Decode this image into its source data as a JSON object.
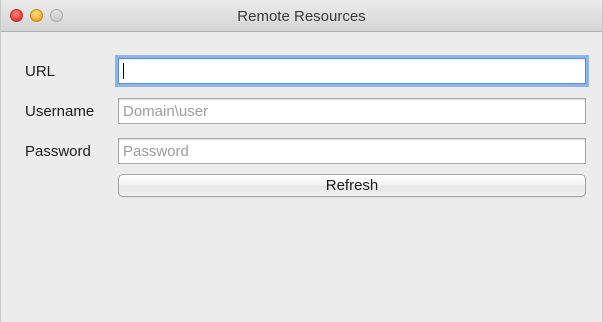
{
  "window": {
    "title": "Remote Resources"
  },
  "form": {
    "url": {
      "label": "URL",
      "value": "",
      "placeholder": ""
    },
    "username": {
      "label": "Username",
      "value": "",
      "placeholder": "Domain\\user"
    },
    "password": {
      "label": "Password",
      "value": "",
      "placeholder": "Password"
    },
    "refresh_label": "Refresh"
  },
  "colors": {
    "window_background": "#ececec",
    "focus_ring": "#8fb4ea",
    "close_button": "#f3453c",
    "minimize_button": "#f6b737",
    "zoom_button_inactive": "#c9c9c9"
  }
}
